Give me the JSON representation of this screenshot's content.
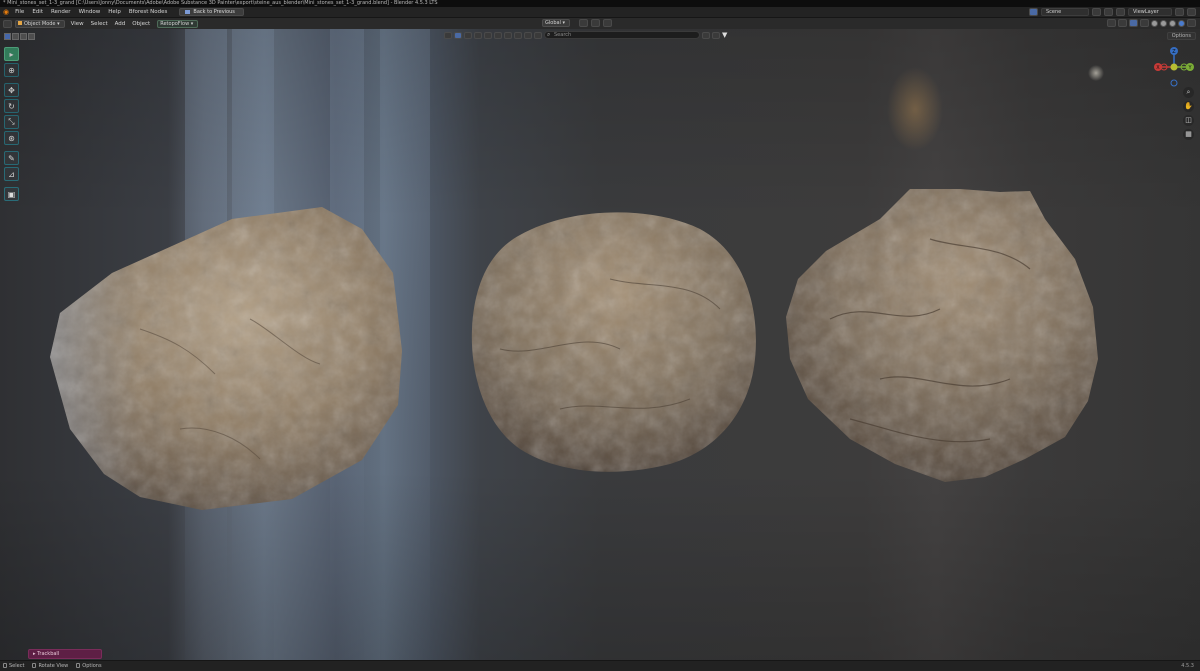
{
  "window": {
    "title": "* Mini_stones_set_1-3_grand [C:\\Users\\Jonny\\Documents\\Adobe\\Adobe Substance 3D Painter\\export\\steine_aus_blender\\Mini_stones_set_1-3_grand.blend] - Blender 4.5.3 LTS"
  },
  "menu": {
    "items": [
      "File",
      "Edit",
      "Render",
      "Window",
      "Help",
      "Bforest Nodes"
    ],
    "back_button": "Back to Previous"
  },
  "topbar_right": {
    "scene_label": "Scene",
    "view_layer_label": "ViewLayer"
  },
  "viewport_header": {
    "mode": "Object Mode",
    "menu": [
      "View",
      "Select",
      "Add",
      "Object"
    ],
    "extra_mode": "RetopoFlow",
    "orientation": "Global",
    "search_placeholder": "Search"
  },
  "viewport": {
    "options_label": "Options",
    "gizmo": {
      "x_label": "X",
      "y_label": "Y",
      "z_label": "Z",
      "colors": {
        "x": "#e2423e",
        "y": "#8bc43d",
        "z": "#3d7ee0"
      }
    },
    "nav_icons": [
      "zoom-icon",
      "pan-hand-icon",
      "camera-icon",
      "grid-icon"
    ]
  },
  "tools": [
    "select-box-icon",
    "cursor-icon",
    "move-icon",
    "rotate-icon",
    "scale-icon",
    "transform-icon",
    "annotate-icon",
    "measure-icon",
    "add-cube-icon"
  ],
  "operator_panel": {
    "label": "Trackball"
  },
  "statusbar": {
    "items": [
      "Select",
      "Rotate View",
      "Options"
    ],
    "version": "4.5.3"
  },
  "colors": {
    "stone_base": "#8a7660",
    "stone_light": "#b8a58a",
    "stone_shadow": "#4a3e33",
    "active_tool": "#3a8d67"
  }
}
